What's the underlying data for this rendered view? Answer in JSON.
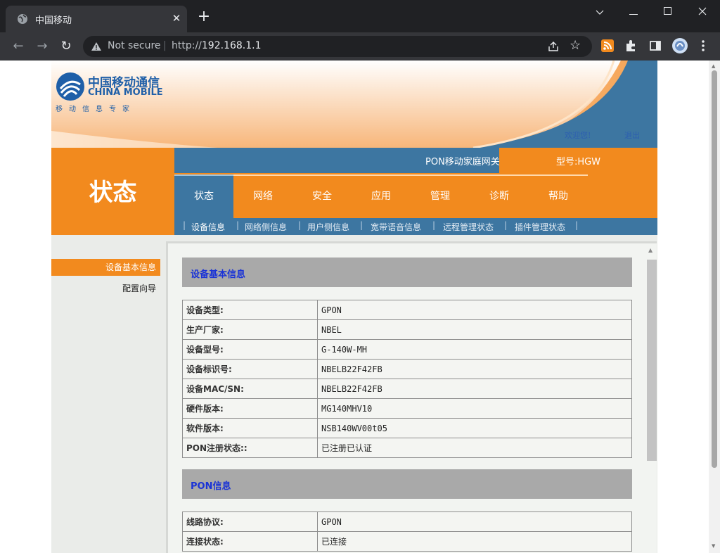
{
  "browser": {
    "tab_title": "中国移动",
    "tab_close": "✕",
    "new_tab": "+",
    "not_secure": "Not secure",
    "url_prefix": "http://",
    "url_host": "192.168.1.1",
    "window_controls": [
      "chevron-down-icon",
      "minimize-icon",
      "maximize-icon",
      "close-icon"
    ],
    "toolbar_icons": [
      "rss-icon",
      "extensions-icon",
      "sidepanel-icon",
      "profile-avatar",
      "menu-icon"
    ]
  },
  "header": {
    "logo_cn": "中国移动通信",
    "logo_en": "CHINA MOBILE",
    "logo_slogan": "移动信息专家",
    "welcome": "欢迎您!",
    "logout": "退出",
    "page_title": "状态",
    "gateway_name": "PON移动家庭网关",
    "model": "型号:HGW"
  },
  "nav": {
    "tabs": [
      "状态",
      "网络",
      "安全",
      "应用",
      "管理",
      "诊断",
      "帮助"
    ],
    "active_index": 0,
    "subtabs": [
      "设备信息",
      "网络侧信息",
      "用户侧信息",
      "宽带语音信息",
      "远程管理状态",
      "插件管理状态"
    ],
    "active_subtab": 0
  },
  "sidebar": {
    "items": [
      "设备基本信息",
      "配置向导"
    ],
    "active_index": 0
  },
  "main": {
    "device_section_title": "设备基本信息",
    "device_rows": [
      {
        "label": "设备类型:",
        "value": "GPON"
      },
      {
        "label": "生产厂家:",
        "value": "NBEL"
      },
      {
        "label": "设备型号:",
        "value": "G-140W-MH"
      },
      {
        "label": "设备标识号:",
        "value": "NBELB22F42FB"
      },
      {
        "label": "设备MAC/SN:",
        "value": "NBELB22F42FB"
      },
      {
        "label": "硬件版本:",
        "value": "MG140MHV10"
      },
      {
        "label": "软件版本:",
        "value": "NSB140WV00t05"
      },
      {
        "label": "PON注册状态::",
        "value": "已注册已认证"
      }
    ],
    "pon_section_title": "PON信息",
    "pon_rows": [
      {
        "label": "线路协议:",
        "value": "GPON"
      },
      {
        "label": "连接状态:",
        "value": "已连接"
      }
    ]
  },
  "colors": {
    "orange": "#f28a1e",
    "blue": "#3d76a1",
    "section_header": "#a9a9a9",
    "section_title_text": "#1a33d6"
  }
}
